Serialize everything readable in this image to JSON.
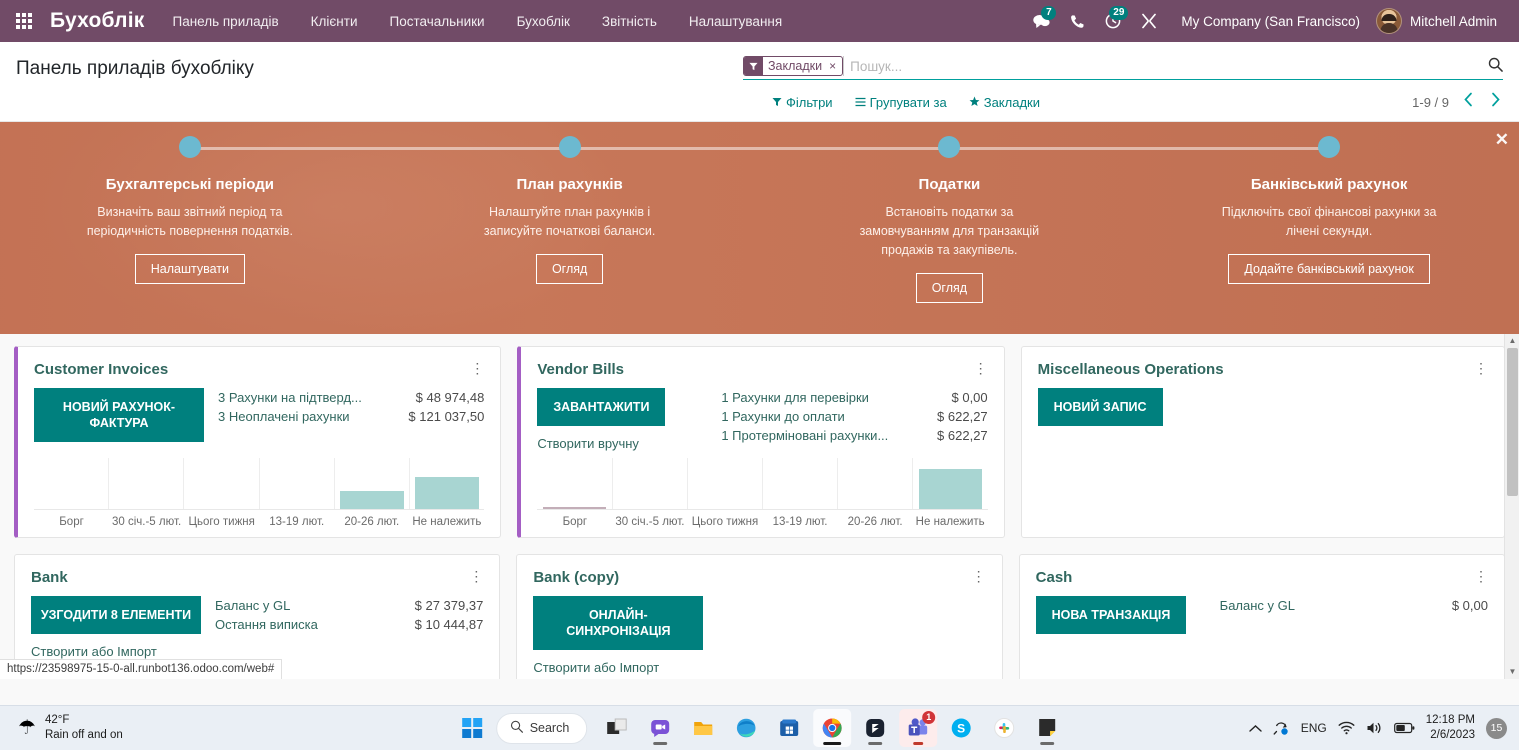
{
  "navbar": {
    "apps_icon": "apps-grid-icon",
    "brand": "Бухоблік",
    "menu": [
      {
        "label": "Панель приладів"
      },
      {
        "label": "Клієнти"
      },
      {
        "label": "Постачальники"
      },
      {
        "label": "Бухоблік"
      },
      {
        "label": "Звітність"
      },
      {
        "label": "Налаштування"
      }
    ],
    "messages_icon": "chat-bubble-icon",
    "messages_count": "7",
    "phone_icon": "phone-icon",
    "activity_icon": "clock-activity-icon",
    "activity_count": "29",
    "tools_icon": "wrench-icon",
    "company": "My Company (San Francisco)",
    "avatar_icon": "user-avatar",
    "user": "Mitchell Admin"
  },
  "control_panel": {
    "title": "Панель приладів бухобліку",
    "facet": {
      "icon": "filter-icon",
      "label": "Закладки",
      "remove": "×"
    },
    "search_placeholder": "Пошук...",
    "search_value": "",
    "search_icon": "magnifier-icon",
    "filters_label": "Фільтри",
    "filters_icon": "filter-icon",
    "groupby_label": "Групувати за",
    "groupby_icon": "hamburger-icon",
    "favorites_label": "Закладки",
    "favorites_icon": "star-icon",
    "pager": "1-9 / 9",
    "prev_icon": "chevron-left-icon",
    "next_icon": "chevron-right-icon"
  },
  "banner": {
    "close_icon": "close-icon",
    "steps": [
      {
        "title": "Бухгалтерські періоди",
        "desc": "Визначіть ваш звітний період та періодичність повернення податків.",
        "button": "Налаштувати"
      },
      {
        "title": "План рахунків",
        "desc": "Налаштуйте план рахунків і записуйте початкові баланси.",
        "button": "Огляд"
      },
      {
        "title": "Податки",
        "desc": "Встановіть податки за замовчуванням для транзакцій продажів та закупівель.",
        "button": "Огляд"
      },
      {
        "title": "Банківський рахунок",
        "desc": "Підключіть свої фінансові рахунки за лічені секунди.",
        "button": "Додайте банківський рахунок"
      }
    ]
  },
  "cards": {
    "customer_invoices": {
      "title": "Customer Invoices",
      "menu_icon": "kebab-menu-icon",
      "button": "Новий Рахунок-фактура",
      "stats": [
        {
          "label": "3 Рахунки на підтверд...",
          "value": "$ 48 974,48"
        },
        {
          "label": "3 Неоплачені рахунки",
          "value": "$ 121 037,50"
        }
      ]
    },
    "vendor_bills": {
      "title": "Vendor Bills",
      "menu_icon": "kebab-menu-icon",
      "button": "Завантажити",
      "sublink": "Створити вручну",
      "stats": [
        {
          "label": "1 Рахунки для перевірки",
          "value": "$ 0,00"
        },
        {
          "label": "1 Рахунки до оплати",
          "value": "$ 622,27"
        },
        {
          "label": "1 Протерміновані рахунки...",
          "value": "$ 622,27"
        }
      ]
    },
    "misc_operations": {
      "title": "Miscellaneous Operations",
      "menu_icon": "kebab-menu-icon",
      "button": "Новий запис"
    },
    "bank": {
      "title": "Bank",
      "menu_icon": "kebab-menu-icon",
      "button": "Узгодити 8 Елементи",
      "stats": [
        {
          "label": "Баланс у GL",
          "value": "$ 27 379,37"
        },
        {
          "label": "Остання виписка",
          "value": "$ 10 444,87"
        }
      ]
    },
    "bank_copy": {
      "title": "Bank (copy)",
      "menu_icon": "kebab-menu-icon",
      "button": "Онлайн-синхронізація",
      "sublink": "Створити або Імпорт Виписки"
    },
    "cash": {
      "title": "Cash",
      "menu_icon": "kebab-menu-icon",
      "button": "Нова транзакція",
      "stats": [
        {
          "label": "Баланс у GL",
          "value": "$ 0,00"
        }
      ]
    }
  },
  "chart_data": [
    {
      "type": "bar",
      "title": "Customer Invoices",
      "categories": [
        "Борг",
        "30 січ.-5 лют.",
        "Цього тижня",
        "13-19 лют.",
        "20-26 лют.",
        "Не належить"
      ],
      "values": [
        0,
        0,
        0,
        0,
        35,
        62
      ],
      "ylim": [
        0,
        100
      ],
      "xlabel": "",
      "ylabel": "",
      "grid": true,
      "legend": "none"
    },
    {
      "type": "bar",
      "title": "Vendor Bills",
      "categories": [
        "Борг",
        "30 січ.-5 лют.",
        "Цього тижня",
        "13-19 лют.",
        "20-26 лют.",
        "Не належить"
      ],
      "values": [
        1,
        0,
        0,
        0,
        0,
        78
      ],
      "ylim": [
        0,
        100
      ],
      "xlabel": "",
      "ylabel": "",
      "grid": true,
      "legend": "none"
    }
  ],
  "status_url": "https://23598975-15-0-all.runbot136.odoo.com/web#",
  "taskbar": {
    "weather_icon": "rain-umbrella-icon",
    "weather_temp": "42°F",
    "weather_desc": "Rain off and on",
    "start_icon": "windows-start-icon",
    "search_label": "Search",
    "search_icon": "magnifier-icon",
    "apps": [
      {
        "name": "task-view-icon"
      },
      {
        "name": "teams-chat-icon"
      },
      {
        "name": "file-explorer-icon"
      },
      {
        "name": "edge-icon"
      },
      {
        "name": "microsoft-store-icon"
      },
      {
        "name": "chrome-icon"
      },
      {
        "name": "code-editor-icon"
      },
      {
        "name": "teams-icon",
        "badge": "1"
      },
      {
        "name": "skype-icon"
      },
      {
        "name": "slack-icon"
      },
      {
        "name": "sticky-notes-icon"
      }
    ],
    "tray": {
      "chevron_icon": "chevron-up-icon",
      "sync_icon": "onedrive-sync-icon",
      "language": "ENG",
      "wifi_icon": "wifi-icon",
      "volume_icon": "speaker-icon",
      "battery_icon": "battery-icon",
      "time": "12:18 PM",
      "date": "2/6/2023",
      "notifications": "15"
    }
  }
}
